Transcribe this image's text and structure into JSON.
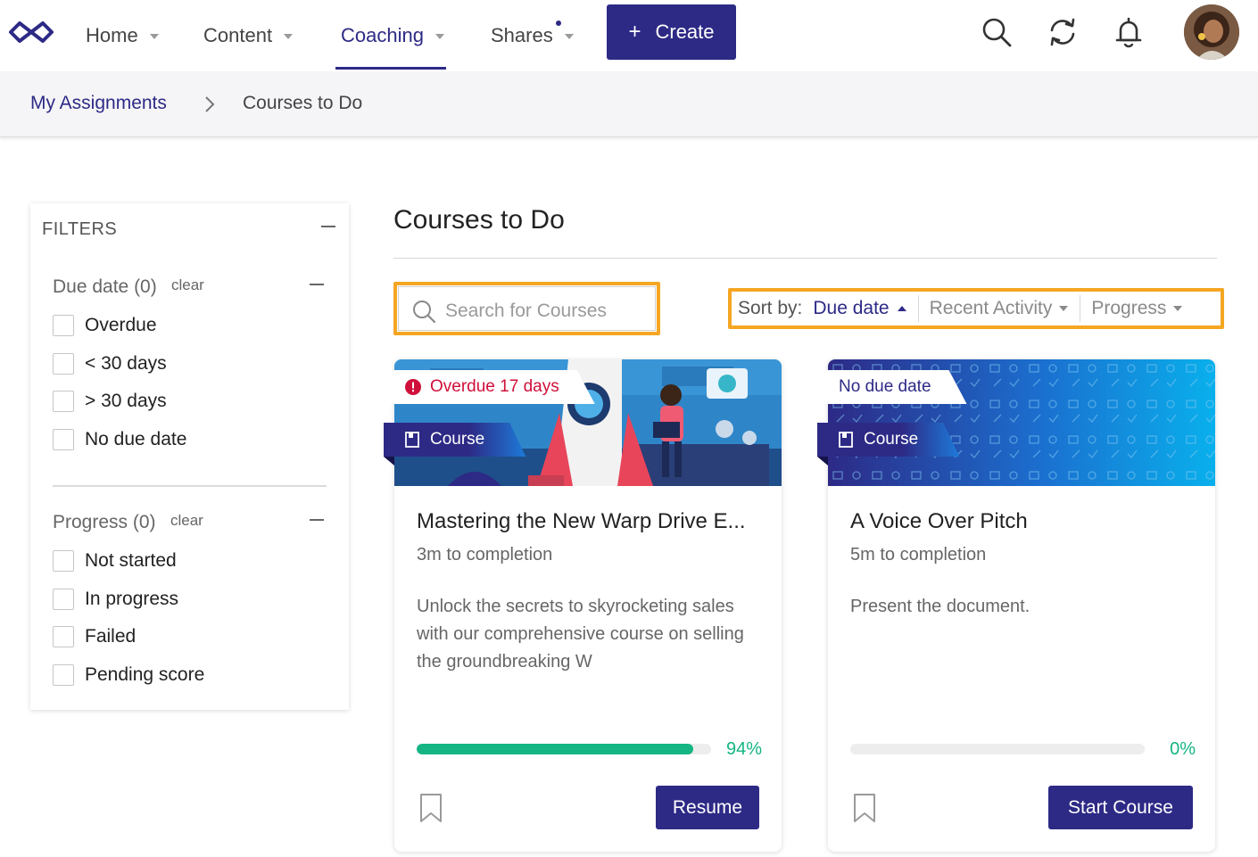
{
  "nav": {
    "items": [
      {
        "label": "Home"
      },
      {
        "label": "Content"
      },
      {
        "label": "Coaching"
      },
      {
        "label": "Shares"
      }
    ],
    "active_item": "Coaching",
    "create_label": "Create"
  },
  "breadcrumb": {
    "parent": "My Assignments",
    "current": "Courses to Do"
  },
  "filters": {
    "title": "FILTERS",
    "due_date": {
      "title": "Due date (0)",
      "clear": "clear",
      "options": [
        "Overdue",
        "< 30 days",
        "> 30 days",
        "No due date"
      ]
    },
    "progress": {
      "title": "Progress (0)",
      "clear": "clear",
      "options": [
        "Not started",
        "In progress",
        "Failed",
        "Pending score"
      ]
    }
  },
  "main": {
    "title": "Courses to Do",
    "search_placeholder": "Search for Courses",
    "sort": {
      "label": "Sort by:",
      "active": "Due date",
      "options": [
        "Recent Activity",
        "Progress"
      ]
    }
  },
  "cards": [
    {
      "status": "Overdue 17 days",
      "type": "Course",
      "title": "Mastering the New Warp Drive E...",
      "time": "3m to completion",
      "description": "Unlock the secrets to skyrocketing sales with our comprehensive course on selling the groundbreaking W",
      "progress": 94,
      "progress_label": "94%",
      "button": "Resume"
    },
    {
      "status": "No due date",
      "type": "Course",
      "title": "A Voice Over Pitch",
      "time": "5m to completion",
      "description": "Present the document.",
      "progress": 0,
      "progress_label": "0%",
      "button": "Start Course"
    }
  ],
  "colors": {
    "primary": "#2d2a86",
    "highlight": "#f5a623",
    "success": "#14b583",
    "overdue": "#d0103a"
  }
}
